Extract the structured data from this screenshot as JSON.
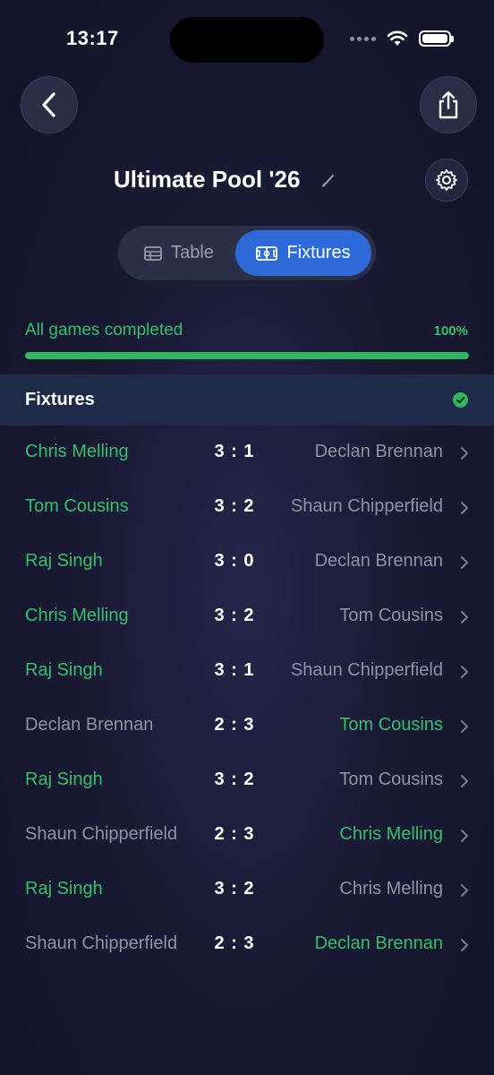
{
  "status_bar": {
    "time": "13:17"
  },
  "header": {
    "title": "Ultimate Pool '26"
  },
  "tabs": [
    {
      "label": "Table",
      "active": false
    },
    {
      "label": "Fixtures",
      "active": true
    }
  ],
  "progress": {
    "label": "All games completed",
    "percent_text": "100%",
    "value": 1.0
  },
  "section": {
    "title": "Fixtures"
  },
  "colors": {
    "accent": "#2f6ad9",
    "winner": "#34c06b",
    "loser": "#8f92a3"
  },
  "fixtures": [
    {
      "home": "Chris Melling",
      "score": "3 : 1",
      "away": "Declan Brennan",
      "winner": "home"
    },
    {
      "home": "Tom Cousins",
      "score": "3 : 2",
      "away": "Shaun Chipperfield",
      "winner": "home"
    },
    {
      "home": "Raj Singh",
      "score": "3 : 0",
      "away": "Declan Brennan",
      "winner": "home"
    },
    {
      "home": "Chris Melling",
      "score": "3 : 2",
      "away": "Tom Cousins",
      "winner": "home"
    },
    {
      "home": "Raj Singh",
      "score": "3 : 1",
      "away": "Shaun Chipperfield",
      "winner": "home"
    },
    {
      "home": "Declan Brennan",
      "score": "2 : 3",
      "away": "Tom Cousins",
      "winner": "away"
    },
    {
      "home": "Raj Singh",
      "score": "3 : 2",
      "away": "Tom Cousins",
      "winner": "home"
    },
    {
      "home": "Shaun Chipperfield",
      "score": "2 : 3",
      "away": "Chris Melling",
      "winner": "away"
    },
    {
      "home": "Raj Singh",
      "score": "3 : 2",
      "away": "Chris Melling",
      "winner": "home"
    },
    {
      "home": "Shaun Chipperfield",
      "score": "2 : 3",
      "away": "Declan Brennan",
      "winner": "away"
    }
  ]
}
